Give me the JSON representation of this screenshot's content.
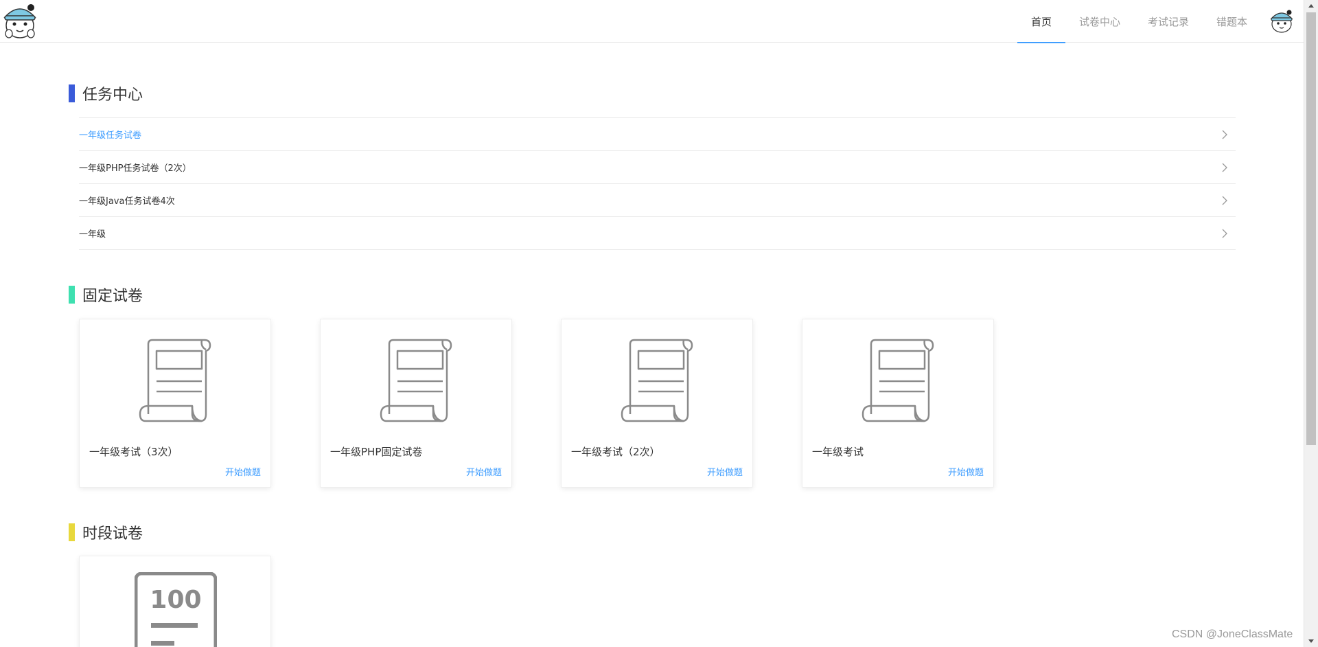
{
  "header": {
    "nav": [
      {
        "label": "首页",
        "active": true
      },
      {
        "label": "试卷中心",
        "active": false
      },
      {
        "label": "考试记录",
        "active": false
      },
      {
        "label": "错题本",
        "active": false
      }
    ]
  },
  "sections": {
    "task_center": {
      "title": "任务中心",
      "color": "#3a5bd9"
    },
    "fixed_papers": {
      "title": "固定试卷",
      "color": "#3ee0b0"
    },
    "timed_papers": {
      "title": "时段试卷",
      "color": "#e8d83c"
    }
  },
  "tasks": [
    {
      "label": "一年级任务试卷",
      "active": true
    },
    {
      "label": "一年级PHP任务试卷（2次）",
      "active": false
    },
    {
      "label": "一年级Java任务试卷4次",
      "active": false
    },
    {
      "label": "一年级",
      "active": false
    }
  ],
  "fixed_cards": [
    {
      "title": "一年级考试（3次）",
      "action": "开始做题"
    },
    {
      "title": "一年级PHP固定试卷",
      "action": "开始做题"
    },
    {
      "title": "一年级考试（2次）",
      "action": "开始做题"
    },
    {
      "title": "一年级考试",
      "action": "开始做题"
    }
  ],
  "timed_cards": [
    {
      "icon_text": "100"
    }
  ],
  "watermark": "CSDN @JoneClassMate",
  "colors": {
    "accent": "#409eff",
    "icon_gray": "#8a8a8a"
  },
  "icons": {
    "logo": "cartoon-avatar-logo",
    "avatar": "user-avatar-icon",
    "paper": "scroll-paper-icon",
    "score": "score-100-icon",
    "arrow": "chevron-right-icon"
  }
}
